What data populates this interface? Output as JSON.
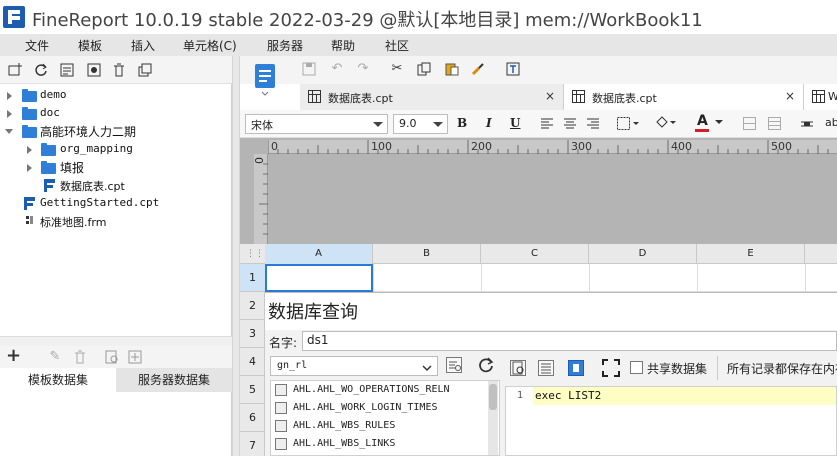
{
  "app": {
    "title": "FineReport 10.0.19 stable 2022-03-29 @默认[本地目录]    mem://WorkBook11"
  },
  "menu": {
    "items": [
      "文件",
      "模板",
      "插入",
      "单元格(C)",
      "服务器",
      "帮助",
      "社区"
    ]
  },
  "tree": {
    "items": [
      {
        "label": "demo",
        "type": "folder",
        "expanded": false
      },
      {
        "label": "doc",
        "type": "folder",
        "expanded": false
      },
      {
        "label": "高能环境人力二期",
        "type": "folder",
        "expanded": true
      },
      {
        "label": "org_mapping",
        "type": "folder",
        "expanded": false
      },
      {
        "label": "填报",
        "type": "folder",
        "expanded": false
      },
      {
        "label": "数据底表.cpt",
        "type": "cpt"
      },
      {
        "label": "GettingStarted.cpt",
        "type": "cpt"
      },
      {
        "label": "标准地图.frm",
        "type": "frm"
      }
    ]
  },
  "dataset_tabs": {
    "template": "模板数据集",
    "server": "服务器数据集"
  },
  "doc_tabs": [
    {
      "label": "数据底表.cpt",
      "close": "×"
    },
    {
      "label": "数据底表.cpt",
      "close": "×"
    },
    {
      "label": "W"
    }
  ],
  "format": {
    "font_family": "宋体",
    "font_size": "9.0",
    "bold": "B",
    "italic": "I",
    "underline": "U",
    "text_color_label": "A",
    "text_color": "#d0202a",
    "ab_label": "ab"
  },
  "ruler": {
    "marks": [
      "0",
      "100",
      "200",
      "300",
      "400",
      "500"
    ],
    "vmark": "0"
  },
  "grid": {
    "columns": [
      "A",
      "B",
      "C",
      "D",
      "E"
    ],
    "rows": [
      "1",
      "2",
      "3",
      "4",
      "5",
      "6",
      "7"
    ]
  },
  "dialog": {
    "title": "数据库查询",
    "name_label": "名字:",
    "name_value": "ds1",
    "connection": "gn_rl",
    "tables": [
      "AHL.AHL_WO_OPERATIONS_RELN",
      "AHL.AHL_WORK_LOGIN_TIMES",
      "AHL.AHL_WBS_RULES",
      "AHL.AHL_WBS_LINKS"
    ],
    "share_label": "共享数据集",
    "save_all_label": "所有记录都保存在内存",
    "sql_line_no": "1",
    "sql_text": "exec LIST2"
  },
  "colors": {
    "accent": "#2b7bd4",
    "folder": "#2f7ed8",
    "menubar": "#e6e6e6",
    "sql_highlight": "#fefdc3"
  }
}
